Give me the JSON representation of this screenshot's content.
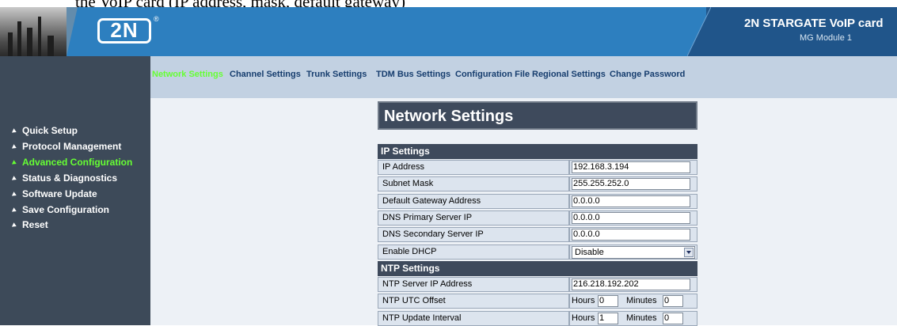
{
  "doc_caption": "the VoIP card (IP address, mask, default gateway)",
  "header": {
    "logo": "2N",
    "registered": "®",
    "product": "2N STARGATE VoIP card",
    "module": "MG Module 1"
  },
  "sidebar": {
    "items": [
      {
        "label": "Quick Setup"
      },
      {
        "label": "Protocol Management"
      },
      {
        "label": "Advanced Configuration",
        "active": true
      },
      {
        "label": "Status & Diagnostics"
      },
      {
        "label": "Software Update"
      },
      {
        "label": "Save Configuration"
      },
      {
        "label": "Reset"
      }
    ]
  },
  "nav": {
    "tabs": [
      {
        "label": "Network Settings",
        "active": true
      },
      {
        "label": "Channel Settings"
      },
      {
        "label": "Trunk Settings"
      },
      {
        "label": "TDM Bus Settings"
      },
      {
        "label": "Configuration File"
      },
      {
        "label": "Regional Settings"
      },
      {
        "label": "Change Password"
      }
    ]
  },
  "panel": {
    "title": "Network Settings",
    "ip_section": "IP Settings",
    "ip_rows": [
      {
        "label": "IP Address",
        "value": "192.168.3.194"
      },
      {
        "label": "Subnet Mask",
        "value": "255.255.252.0"
      },
      {
        "label": "Default Gateway Address",
        "value": "0.0.0.0"
      },
      {
        "label": "DNS Primary Server IP",
        "value": "0.0.0.0"
      },
      {
        "label": "DNS Secondary Server IP",
        "value": "0.0.0.0"
      }
    ],
    "dhcp": {
      "label": "Enable DHCP",
      "value": "Disable"
    },
    "ntp_section": "NTP Settings",
    "ntp_server": {
      "label": "NTP Server IP Address",
      "value": "216.218.192.202"
    },
    "ntp_offset": {
      "label": "NTP UTC Offset",
      "hours_label": "Hours",
      "hours": "0",
      "minutes_label": "Minutes",
      "minutes": "0"
    },
    "ntp_interval": {
      "label": "NTP Update Interval",
      "hours_label": "Hours",
      "hours": "1",
      "minutes_label": "Minutes",
      "minutes": "0"
    }
  },
  "colors": {
    "header_blue": "#2d7fbf",
    "sidebar": "#3d4a59",
    "active_green": "#66ff33",
    "section_bg": "#3e4a5c"
  }
}
